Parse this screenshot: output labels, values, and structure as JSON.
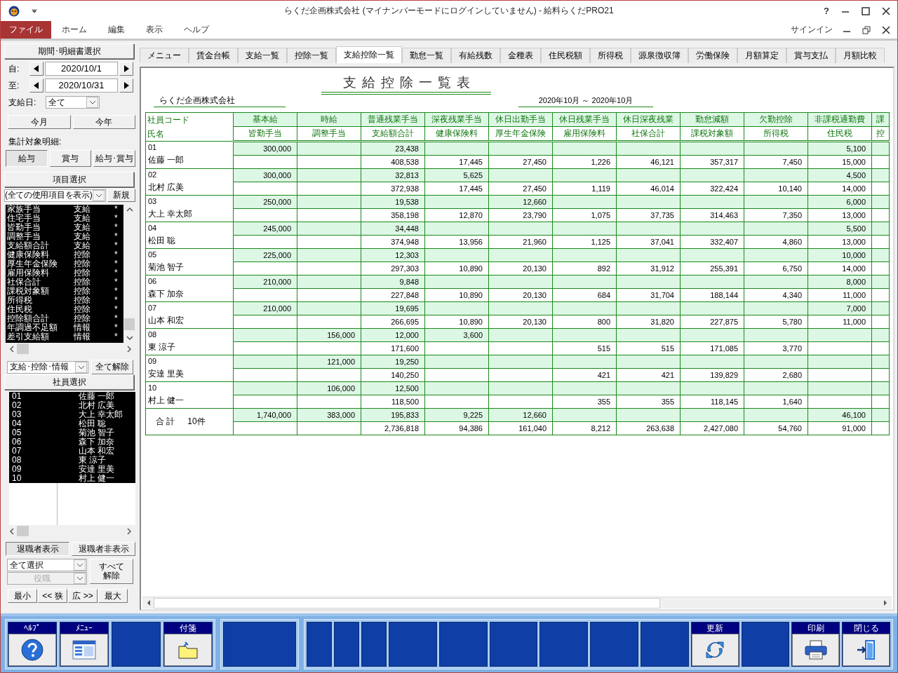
{
  "window": {
    "title": "らくだ企画株式会社 (マイナンバーモードにログインしていません) - 給料らくだPRO21",
    "help": "?",
    "account": "サインイン"
  },
  "menu": [
    {
      "label": "ファイル",
      "selected": true
    },
    {
      "label": "ホーム",
      "selected": false
    },
    {
      "label": "編集",
      "selected": false
    },
    {
      "label": "表示",
      "selected": false
    },
    {
      "label": "ヘルプ",
      "selected": false
    }
  ],
  "period_panel": {
    "header": "期間･明細書選択",
    "from_label": "自:",
    "from_value": "2020/10/1",
    "to_label": "至:",
    "to_value": "2020/10/31",
    "payday_label": "支給日:",
    "payday_value": "全て",
    "buttons": [
      "今月",
      "今年"
    ],
    "target_label": "集計対象明細:",
    "targets": [
      {
        "label": "給与",
        "selected": true
      },
      {
        "label": "賞与",
        "selected": false
      },
      {
        "label": "給与･賞与",
        "selected": false
      }
    ]
  },
  "item_panel": {
    "header": "項目選択",
    "filter_value": "(全ての使用項目を表示)",
    "new_button": "新規",
    "category_value": "支給･控除･情報",
    "clear_button": "全て解除",
    "items": [
      {
        "name": "家族手当",
        "type": "支給",
        "mark": "*",
        "selected": true
      },
      {
        "name": "住宅手当",
        "type": "支給",
        "mark": "*",
        "selected": true
      },
      {
        "name": "皆勤手当",
        "type": "支給",
        "mark": "*",
        "selected": true
      },
      {
        "name": "調整手当",
        "type": "支給",
        "mark": "*",
        "selected": true
      },
      {
        "name": "支給額合計",
        "type": "支給",
        "mark": "*",
        "selected": true
      },
      {
        "name": "健康保険料",
        "type": "控除",
        "mark": "*",
        "selected": true
      },
      {
        "name": "厚生年金保険",
        "type": "控除",
        "mark": "*",
        "selected": true
      },
      {
        "name": "雇用保険料",
        "type": "控除",
        "mark": "*",
        "selected": true
      },
      {
        "name": "社保合計",
        "type": "控除",
        "mark": "*",
        "selected": true
      },
      {
        "name": "課税対象額",
        "type": "控除",
        "mark": "*",
        "selected": true
      },
      {
        "name": "所得税",
        "type": "控除",
        "mark": "*",
        "selected": true
      },
      {
        "name": "住民税",
        "type": "控除",
        "mark": "*",
        "selected": true
      },
      {
        "name": "控除額合計",
        "type": "控除",
        "mark": "*",
        "selected": true
      },
      {
        "name": "年調過不足額",
        "type": "情報",
        "mark": "*",
        "selected": true
      },
      {
        "name": "差引支給額",
        "type": "情報",
        "mark": "*",
        "selected": true
      }
    ]
  },
  "employee_panel": {
    "header": "社員選択",
    "employees": [
      {
        "code": "01",
        "name": "佐藤 一郎",
        "selected": true
      },
      {
        "code": "02",
        "name": "北村 広美",
        "selected": true
      },
      {
        "code": "03",
        "name": "大上 幸太郎",
        "selected": true
      },
      {
        "code": "04",
        "name": "松田 聡",
        "selected": true
      },
      {
        "code": "05",
        "name": "菊池 智子",
        "selected": true
      },
      {
        "code": "06",
        "name": "森下 加奈",
        "selected": true
      },
      {
        "code": "07",
        "name": "山本 和宏",
        "selected": true
      },
      {
        "code": "08",
        "name": "東 涼子",
        "selected": true
      },
      {
        "code": "09",
        "name": "安達 里美",
        "selected": true
      },
      {
        "code": "10",
        "name": "村上 健一",
        "selected": true
      }
    ],
    "retired": [
      {
        "label": "退職者表示",
        "selected": true
      },
      {
        "label": "退職者非表示",
        "selected": false
      }
    ],
    "select_value": "全て選択",
    "position_value": "役職",
    "position_disabled": true,
    "clear_button": "すべて解除",
    "zoom_buttons": [
      "最小",
      "<< 狭",
      "広 >>",
      "最大"
    ]
  },
  "tabs": [
    {
      "label": "メニュー",
      "selected": false
    },
    {
      "label": "賃金台帳",
      "selected": false
    },
    {
      "label": "支給一覧",
      "selected": false
    },
    {
      "label": "控除一覧",
      "selected": false
    },
    {
      "label": "支給控除一覧",
      "selected": true
    },
    {
      "label": "勤怠一覧",
      "selected": false
    },
    {
      "label": "有給残数",
      "selected": false
    },
    {
      "label": "金種表",
      "selected": false
    },
    {
      "label": "住民税額",
      "selected": false
    },
    {
      "label": "所得税",
      "selected": false
    },
    {
      "label": "源泉徴収簿",
      "selected": false
    },
    {
      "label": "労働保険",
      "selected": false
    },
    {
      "label": "月額算定",
      "selected": false
    },
    {
      "label": "賞与支払",
      "selected": false
    },
    {
      "label": "月額比較",
      "selected": false
    }
  ],
  "report": {
    "title": "支給控除一覧表",
    "company": "らくだ企画株式会社",
    "period": "2020年10月 ～ 2020年10月",
    "key_header_top": "社員コード",
    "key_header_bottom": "氏名",
    "columns": [
      {
        "top": "基本給",
        "bottom": "皆勤手当"
      },
      {
        "top": "時給",
        "bottom": "調整手当"
      },
      {
        "top": "普通残業手当",
        "bottom": "支給額合計"
      },
      {
        "top": "深夜残業手当",
        "bottom": "健康保険料"
      },
      {
        "top": "休日出勤手当",
        "bottom": "厚生年金保険"
      },
      {
        "top": "休日残業手当",
        "bottom": "雇用保険料"
      },
      {
        "top": "休日深夜残業",
        "bottom": "社保合計"
      },
      {
        "top": "勤怠減額",
        "bottom": "課税対象額"
      },
      {
        "top": "欠勤控除",
        "bottom": "所得税"
      },
      {
        "top": "非課税通勤費",
        "bottom": "住民税"
      },
      {
        "top": "課",
        "bottom": "控"
      }
    ],
    "rows": [
      {
        "code": "01",
        "name": "佐藤 一郎",
        "top": {
          "0": "300,000",
          "2": "23,438",
          "9": "5,100"
        },
        "bottom": {
          "2": "408,538",
          "3": "17,445",
          "4": "27,450",
          "5": "1,226",
          "6": "46,121",
          "7": "357,317",
          "8": "7,450",
          "9": "15,000"
        }
      },
      {
        "code": "02",
        "name": "北村 広美",
        "top": {
          "0": "300,000",
          "2": "32,813",
          "3": "5,625",
          "9": "4,500"
        },
        "bottom": {
          "2": "372,938",
          "3": "17,445",
          "4": "27,450",
          "5": "1,119",
          "6": "46,014",
          "7": "322,424",
          "8": "10,140",
          "9": "14,000"
        }
      },
      {
        "code": "03",
        "name": "大上 幸太郎",
        "top": {
          "0": "250,000",
          "2": "19,538",
          "4": "12,660",
          "9": "6,000"
        },
        "bottom": {
          "2": "358,198",
          "3": "12,870",
          "4": "23,790",
          "5": "1,075",
          "6": "37,735",
          "7": "314,463",
          "8": "7,350",
          "9": "13,000"
        }
      },
      {
        "code": "04",
        "name": "松田 聡",
        "top": {
          "0": "245,000",
          "2": "34,448",
          "9": "5,500"
        },
        "bottom": {
          "2": "374,948",
          "3": "13,956",
          "4": "21,960",
          "5": "1,125",
          "6": "37,041",
          "7": "332,407",
          "8": "4,860",
          "9": "13,000"
        }
      },
      {
        "code": "05",
        "name": "菊池 智子",
        "top": {
          "0": "225,000",
          "2": "12,303",
          "9": "10,000"
        },
        "bottom": {
          "2": "297,303",
          "3": "10,890",
          "4": "20,130",
          "5": "892",
          "6": "31,912",
          "7": "255,391",
          "8": "6,750",
          "9": "14,000"
        }
      },
      {
        "code": "06",
        "name": "森下 加奈",
        "top": {
          "0": "210,000",
          "2": "9,848",
          "9": "8,000"
        },
        "bottom": {
          "2": "227,848",
          "3": "10,890",
          "4": "20,130",
          "5": "684",
          "6": "31,704",
          "7": "188,144",
          "8": "4,340",
          "9": "11,000"
        }
      },
      {
        "code": "07",
        "name": "山本 和宏",
        "top": {
          "0": "210,000",
          "2": "19,695",
          "9": "7,000"
        },
        "bottom": {
          "2": "266,695",
          "3": "10,890",
          "4": "20,130",
          "5": "800",
          "6": "31,820",
          "7": "227,875",
          "8": "5,780",
          "9": "11,000"
        }
      },
      {
        "code": "08",
        "name": "東 涼子",
        "top": {
          "1": "156,000",
          "2": "12,000",
          "3": "3,600"
        },
        "bottom": {
          "2": "171,600",
          "5": "515",
          "6": "515",
          "7": "171,085",
          "8": "3,770"
        }
      },
      {
        "code": "09",
        "name": "安達 里美",
        "top": {
          "1": "121,000",
          "2": "19,250"
        },
        "bottom": {
          "2": "140,250",
          "5": "421",
          "6": "421",
          "7": "139,829",
          "8": "2,680"
        }
      },
      {
        "code": "10",
        "name": "村上 健一",
        "top": {
          "1": "106,000",
          "2": "12,500"
        },
        "bottom": {
          "2": "118,500",
          "5": "355",
          "6": "355",
          "7": "118,145",
          "8": "1,640"
        }
      }
    ],
    "total": {
      "label": "合 計",
      "count": "10件",
      "top": {
        "0": "1,740,000",
        "1": "383,000",
        "2": "195,833",
        "3": "9,225",
        "4": "12,660",
        "9": "46,100"
      },
      "bottom": {
        "2": "2,736,818",
        "3": "94,386",
        "4": "161,040",
        "5": "8,212",
        "6": "263,638",
        "7": "2,427,080",
        "8": "54,760",
        "9": "91,000"
      }
    }
  },
  "function_keys": [
    [
      {
        "kind": "help",
        "label": "ﾍﾙﾌﾟ"
      },
      {
        "kind": "menu",
        "label": "ﾒﾆｭｰ"
      },
      {
        "kind": "blank"
      },
      {
        "kind": "note",
        "label": "付箋"
      }
    ],
    [
      {
        "kind": "wide"
      }
    ],
    [
      {
        "kind": "slim"
      },
      {
        "kind": "slim"
      },
      {
        "kind": "slim"
      },
      {
        "kind": "blank"
      },
      {
        "kind": "blank"
      },
      {
        "kind": "blank"
      },
      {
        "kind": "blank"
      },
      {
        "kind": "blank"
      },
      {
        "kind": "blank"
      },
      {
        "kind": "refresh",
        "label": "更新"
      },
      {
        "kind": "blank"
      },
      {
        "kind": "print",
        "label": "印刷"
      },
      {
        "kind": "exit",
        "label": "閉じる"
      }
    ]
  ]
}
